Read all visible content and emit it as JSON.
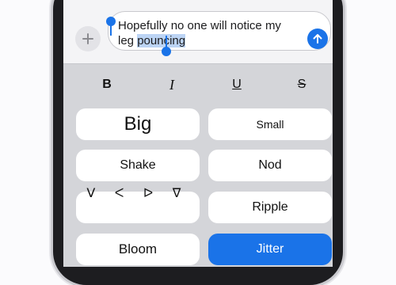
{
  "compose": {
    "plus_label": "+",
    "message_before_selection": "Hopefully no one will notice my leg",
    "message_selected": "pouncing",
    "send_icon": "arrow-up-icon"
  },
  "format_bar": {
    "bold": "B",
    "italic": "I",
    "underline": "U",
    "strikethrough": "S"
  },
  "effects": {
    "big": "Big",
    "small": "Small",
    "shake": "Shake",
    "nod": "Nod",
    "explode_glyphs": "ᐯ ᐸ ᐅ ᐁ",
    "ripple": "Ripple",
    "bloom": "Bloom",
    "jitter": "Jitter",
    "selected": "Jitter"
  },
  "colors": {
    "accent": "#1a73e8",
    "selection": "#bcd4f4",
    "keyboard_bg": "#d4d5d9"
  }
}
